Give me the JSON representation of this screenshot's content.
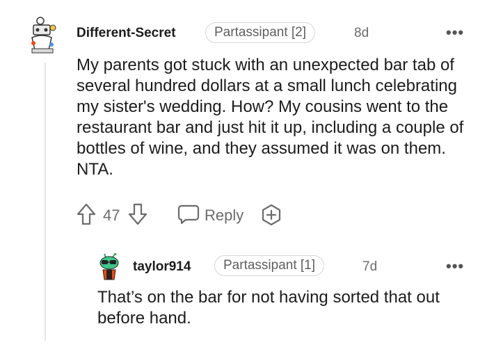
{
  "comments": [
    {
      "username": "Different-Secret",
      "flair": "Partassipant [2]",
      "age": "8d",
      "more": "•••",
      "body": "My parents got stuck with an unexpected bar tab of several hundred dollars at a small lunch celebrating my sister's wedding. How? My cousins went to the restaurant bar and just hit it up, including a couple of bottles of wine, and they assumed it was on them. NTA.",
      "votes": "47",
      "reply_label": "Reply"
    },
    {
      "username": "taylor914",
      "flair": "Partassipant [1]",
      "age": "7d",
      "more": "•••",
      "body": "That’s on the bar for not having sorted that out before hand."
    }
  ],
  "colors": {
    "text": "#1c1c1c",
    "muted": "#6b6b6b",
    "border": "#d6d6d6",
    "thread_line": "#e6e6e6"
  }
}
